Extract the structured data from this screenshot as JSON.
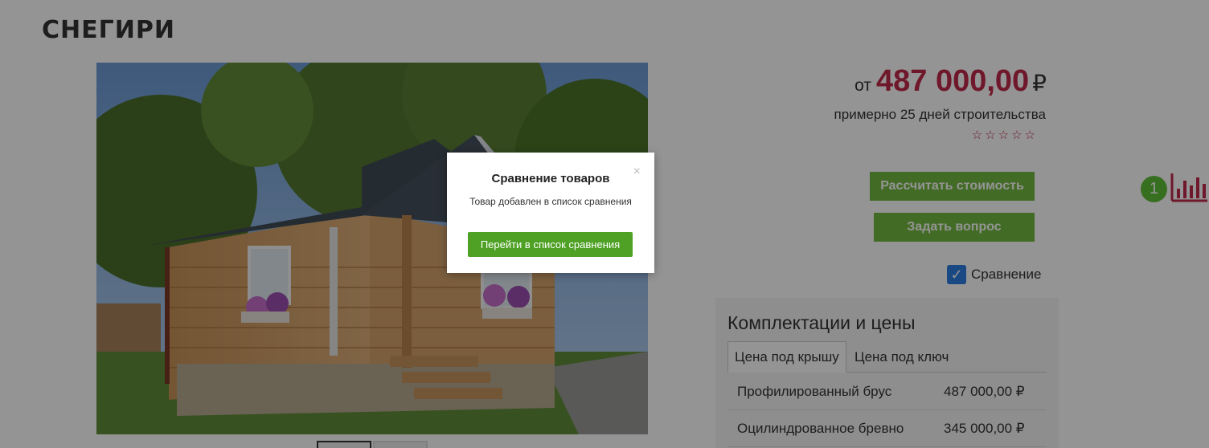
{
  "product": {
    "title": "СНЕГИРИ",
    "price_prefix": "от",
    "price_value": "487 000,00",
    "price_currency": "₽",
    "build_time": "примерно 25 дней строительства",
    "rating_stars": [
      "☆",
      "☆",
      "☆",
      "☆",
      "☆"
    ],
    "calc_button_label": "Рассчитать стоимость",
    "ask_button_label": "Задать вопрос",
    "compare_checkbox_label": "Сравнение",
    "compare_checkbox_mark": "✓"
  },
  "compare_widget": {
    "count": "1",
    "icon": "bar-chart-icon"
  },
  "configurations": {
    "title": "Комплектации и цены",
    "tabs": [
      {
        "label": "Цена под крышу",
        "active": true
      },
      {
        "label": "Цена под ключ",
        "active": false
      }
    ],
    "rows": [
      {
        "name": "Профилированный брус",
        "price": "487 000,00 ₽"
      },
      {
        "name": "Оцилиндрованное бревно",
        "price": "345 000,00 ₽"
      }
    ]
  },
  "modal": {
    "title": "Сравнение товаров",
    "message": "Товар добавлен в список сравнения",
    "button_label": "Перейти в список сравнения",
    "close_symbol": "×"
  },
  "colors": {
    "accent_price": "#c0294a",
    "button_green": "#72b840",
    "modal_button_green": "#4ea124",
    "checkbox_blue": "#2c7de0"
  }
}
